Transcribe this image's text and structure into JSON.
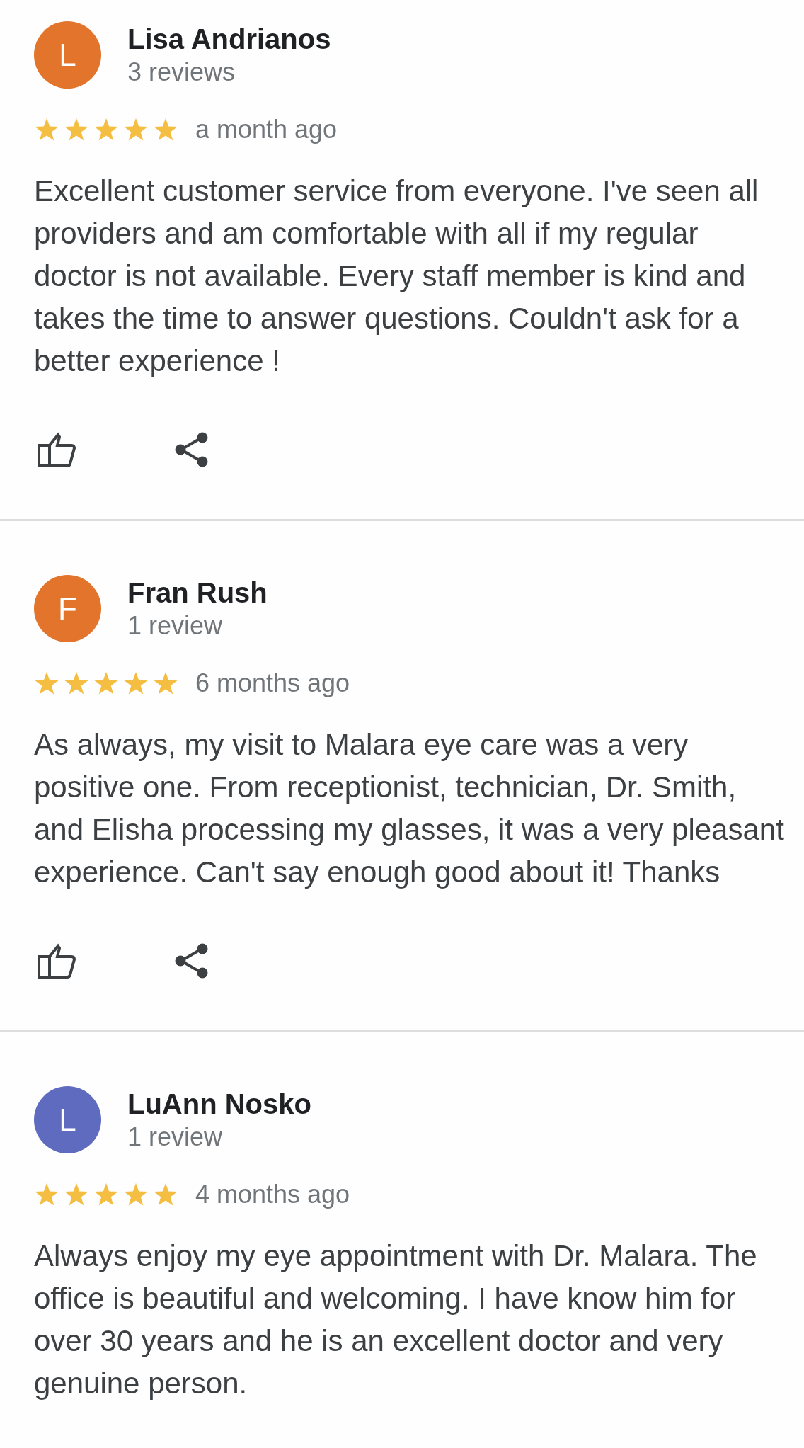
{
  "reviews": [
    {
      "avatar": {
        "initial": "L",
        "color": "#e2742b"
      },
      "name": "Lisa Andrianos",
      "review_count": "3 reviews",
      "stars": 5,
      "time": "a month ago",
      "text": "Excellent customer service from everyone. I've seen all providers and am comfortable with all if my regular doctor is not available. Every staff member is kind and takes the time to answer questions. Couldn't ask for a better experience !",
      "actions": [
        {
          "kind": "like"
        },
        {
          "kind": "share"
        }
      ]
    },
    {
      "avatar": {
        "initial": "F",
        "color": "#e2742b"
      },
      "name": "Fran Rush",
      "review_count": "1 review",
      "stars": 5,
      "time": "6 months ago",
      "text": "As always, my visit to Malara eye care was a very positive one. From receptionist, technician, Dr. Smith, and Elisha processing my glasses, it was a very pleasant experience. Can't say enough good about it! Thanks",
      "actions": [
        {
          "kind": "like"
        },
        {
          "kind": "share"
        }
      ]
    },
    {
      "avatar": {
        "initial": "L",
        "color": "#5f6bbf"
      },
      "name": "LuAnn Nosko",
      "review_count": "1 review",
      "stars": 5,
      "time": "4 months ago",
      "text": "Always enjoy my eye appointment with Dr. Malara. The office is beautiful and welcoming. I have know him for over 30 years and he is an excellent doctor and very genuine person."
    }
  ]
}
